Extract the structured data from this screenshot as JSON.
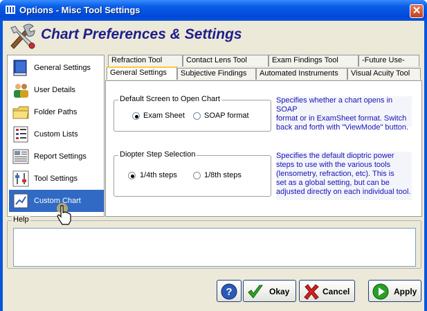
{
  "window": {
    "title": "Options - Misc Tool Settings",
    "close_symbol": "✕",
    "accent": "#0a55dc"
  },
  "header": {
    "title": "Chart Preferences & Settings",
    "icon": "tools-icon"
  },
  "sidebar": {
    "selected": "Custom Chart",
    "items": [
      {
        "label": "General Settings",
        "icon": "book-icon"
      },
      {
        "label": "User Details",
        "icon": "users-icon"
      },
      {
        "label": "Folder Paths",
        "icon": "folder-icon"
      },
      {
        "label": "Custom Lists",
        "icon": "checklist-icon"
      },
      {
        "label": "Report Settings",
        "icon": "report-icon"
      },
      {
        "label": "Tool Settings",
        "icon": "sliders-icon"
      },
      {
        "label": "Custom Chart",
        "icon": "chart-icon"
      }
    ]
  },
  "tabs": {
    "row1": [
      "Refraction Tool",
      "Contact Lens Tool",
      "Exam Findings Tool",
      "-Future Use-"
    ],
    "row2": [
      "General Settings",
      "Subjective Findings",
      "Automated Instruments",
      "Visual Acuity Tool"
    ],
    "active": "General Settings"
  },
  "default_screen": {
    "title": "Default Screen to Open Chart",
    "options": [
      "Exam Sheet",
      "SOAP format"
    ],
    "selected": "Exam Sheet",
    "description": [
      "Specifies whether a chart opens in SOAP",
      "format or in ExamSheet format.  Switch",
      "back and forth with \"ViewMode\" button."
    ]
  },
  "diopter_step": {
    "title": "Diopter Step Selection",
    "options": [
      "1/4th steps",
      "1/8th steps"
    ],
    "selected": "1/4th steps",
    "description": [
      "Specifies the default dioptric power",
      "steps to use with the various tools",
      "(lensometry, refraction, etc).  This is",
      "set as a global setting, but can be",
      "adjusted directly on each individual tool."
    ]
  },
  "help": {
    "title": "Help",
    "value": ""
  },
  "buttons": {
    "help": "?",
    "okay": "Okay",
    "cancel": "Cancel",
    "apply": "Apply"
  }
}
